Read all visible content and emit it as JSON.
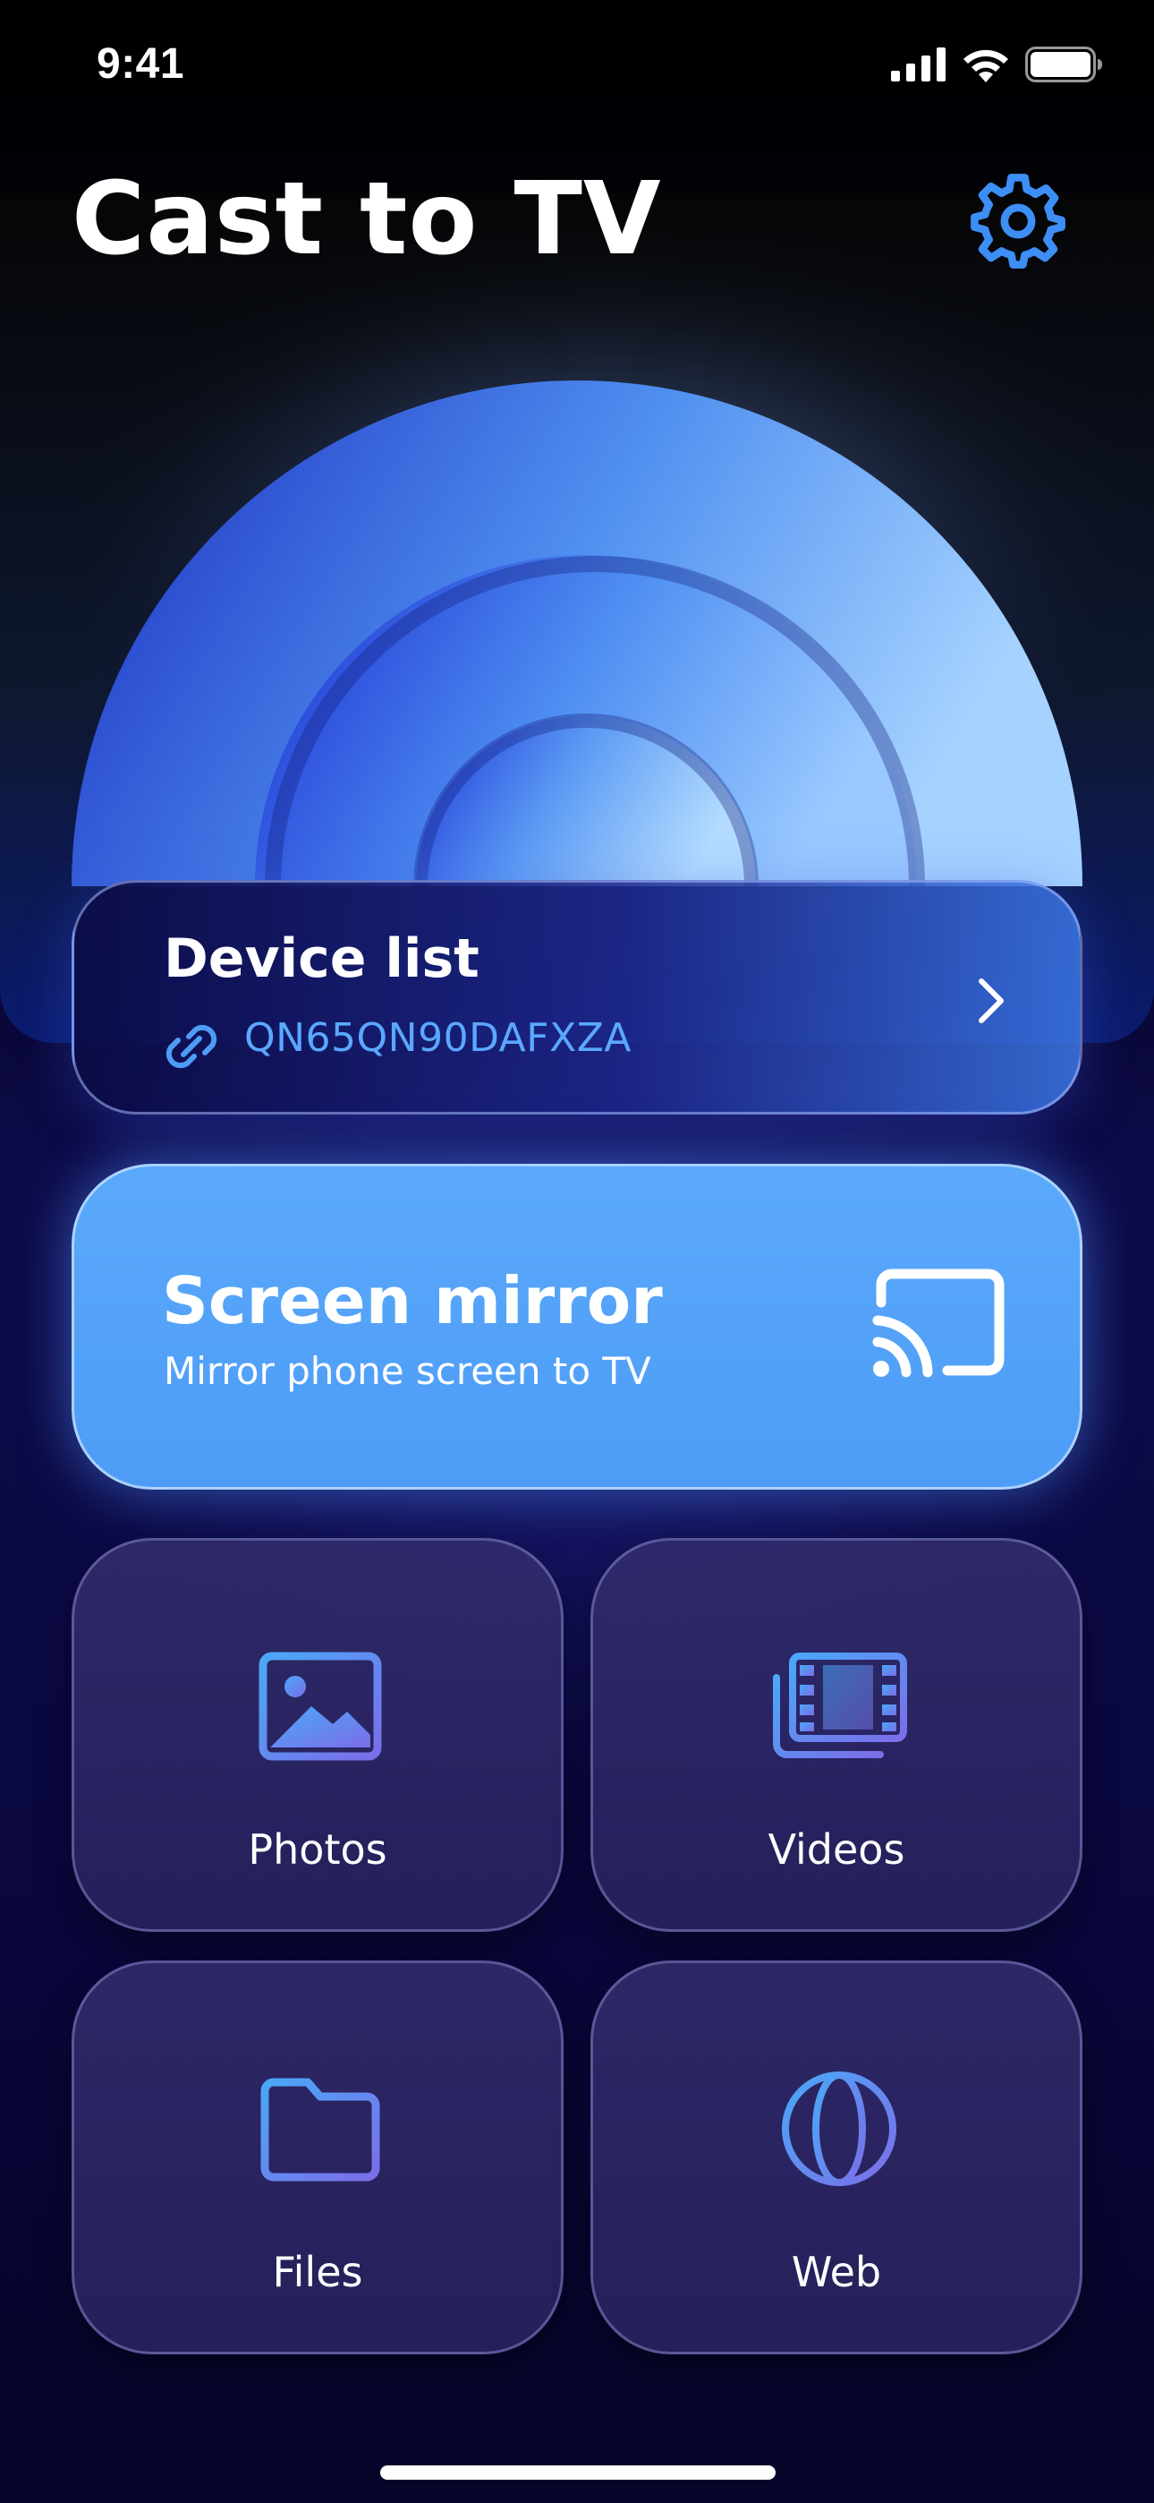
{
  "status_bar": {
    "time": "9:41",
    "icons": [
      "cellular-signal-icon",
      "wifi-icon",
      "battery-icon"
    ]
  },
  "header": {
    "title": "Cast to TV",
    "settings_icon": "gear-icon"
  },
  "device_list": {
    "title": "Device list",
    "connected_device": "QN65QN90DAFXZA",
    "link_icon": "link-icon",
    "chevron_icon": "chevron-right-icon"
  },
  "screen_mirror": {
    "title": "Screen mirror",
    "subtitle": "Mirror phone screen to TV",
    "icon": "cast-icon"
  },
  "tiles": [
    {
      "label": "Photos",
      "icon": "photo-icon"
    },
    {
      "label": "Videos",
      "icon": "film-icon"
    },
    {
      "label": "Files",
      "icon": "folder-icon"
    },
    {
      "label": "Web",
      "icon": "globe-icon"
    }
  ],
  "colors": {
    "accent": "#4d9cf6",
    "link_text": "#5aa8ff",
    "tile_bg": "#2e2968",
    "background": "#07052a"
  }
}
